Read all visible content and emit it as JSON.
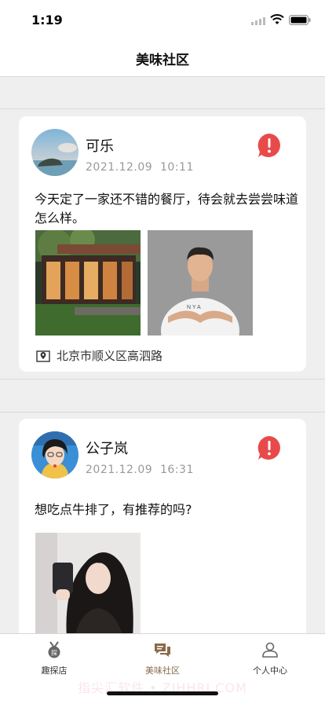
{
  "status_bar": {
    "time": "1:19"
  },
  "nav": {
    "title": "美味社区"
  },
  "posts": [
    {
      "author": "可乐",
      "date": "2021.12.09",
      "time": "10:11",
      "text": "今天定了一家还不错的餐厅，待会就去尝尝味道怎么样。",
      "location": "北京市顺义区高泗路",
      "avatar_icon": "sea-avatar"
    },
    {
      "author": "公子岚",
      "date": "2021.12.09",
      "time": "16:31",
      "text": "想吃点牛排了，有推荐的吗?",
      "avatar_icon": "anime-avatar"
    }
  ],
  "tabs": [
    {
      "label": "趣探店",
      "icon": "medal-icon",
      "active": false
    },
    {
      "label": "美味社区",
      "icon": "chat-bubbles-icon",
      "active": true
    },
    {
      "label": "个人中心",
      "icon": "user-icon",
      "active": false
    }
  ],
  "watermark": "指尖汇软件 • ZJHHRJ.COM",
  "colors": {
    "accent_red": "#e84a4a",
    "active_tab": "#8a6a4a",
    "background": "#efefef"
  }
}
